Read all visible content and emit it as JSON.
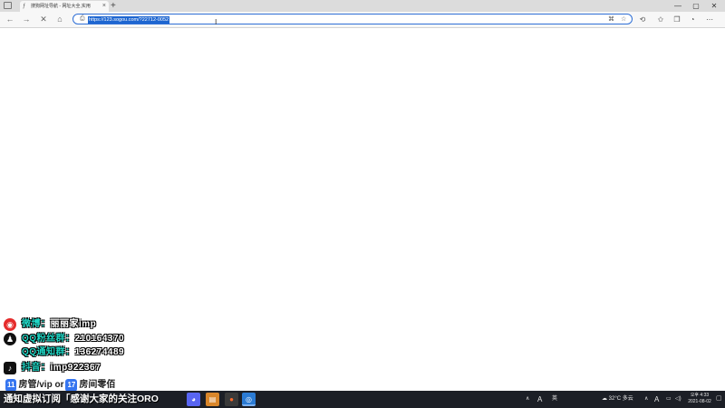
{
  "browser": {
    "tab_title": "搜狗网址导航 - 网址大全,实用",
    "tab_close": "×",
    "new_tab": "+",
    "url": "https://123.sogou.com/?22712-0052",
    "window_minimize": "—",
    "window_maximize": "▢",
    "window_close": "✕"
  },
  "overlay": {
    "weibo_label": "微博：",
    "weibo_value": "丽丽家imp",
    "qq_fan_label": "QQ粉丝群：",
    "qq_fan_value": "210164370",
    "qq_notice_label": "QQ通知群：",
    "qq_notice_value": "136274489",
    "douyin_label": "抖音：",
    "douyin_value": "imp922367",
    "gift_badge_1": "11",
    "gift_text_1": "房管/vip",
    "gift_or": "or",
    "gift_badge_2": "17",
    "gift_text_2": "房间零佰",
    "marquee": "通知虚拟订阅「感谢大家的关注ORO"
  },
  "taskbar": {
    "weather": "32°C 多云",
    "ime_a": "A",
    "ime_lang": "英",
    "clock_time": "오후 4:33",
    "clock_date": "2021-08-02"
  }
}
